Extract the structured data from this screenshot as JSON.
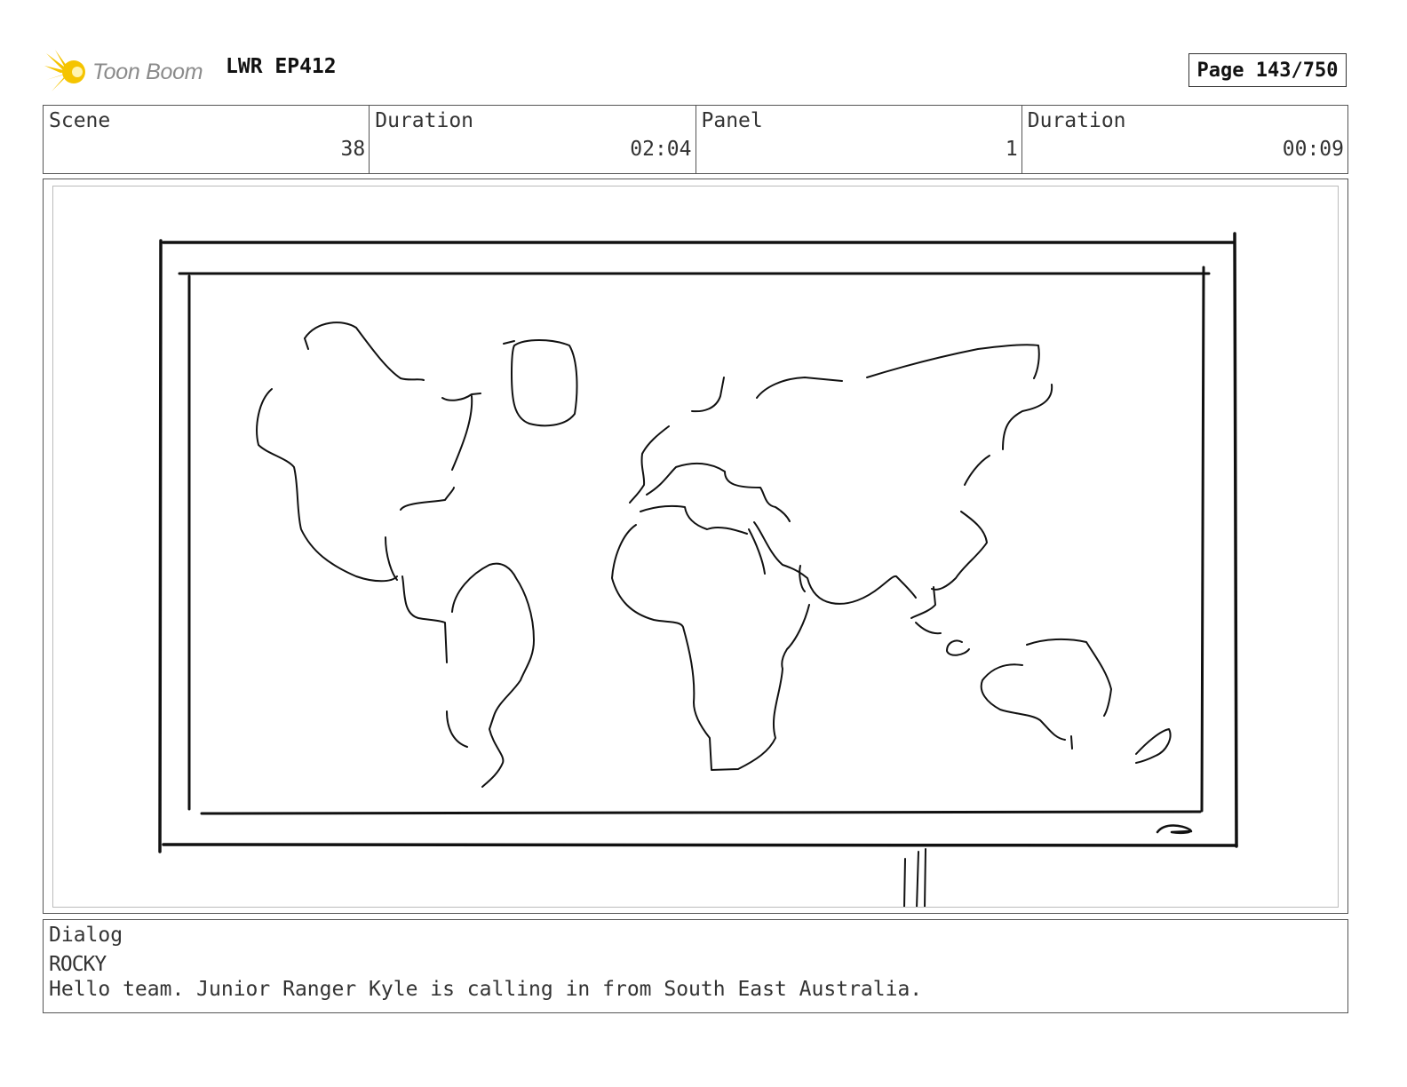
{
  "header": {
    "logo_text": "Toon Boom",
    "project_title": "LWR EP412",
    "page_label": "Page 143/750"
  },
  "info": {
    "scene_label": "Scene",
    "scene_value": "38",
    "scene_duration_label": "Duration",
    "scene_duration_value": "02:04",
    "panel_label": "Panel",
    "panel_value": "1",
    "panel_duration_label": "Duration",
    "panel_duration_value": "00:09"
  },
  "dialog": {
    "label": "Dialog",
    "speaker": "ROCKY",
    "line": "Hello team. Junior Ranger Kyle is calling in from South East Australia."
  },
  "colors": {
    "logo_yellow": "#f5c400",
    "logo_gray": "#8a8a8a",
    "border": "#555555",
    "sketch": "#111111"
  }
}
